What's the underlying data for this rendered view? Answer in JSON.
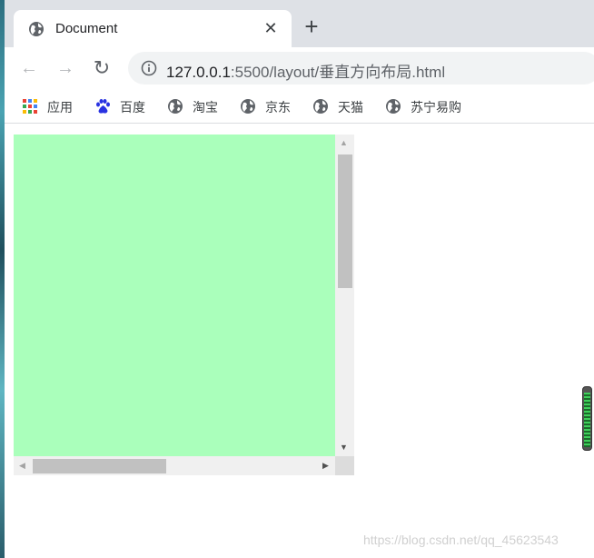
{
  "tab": {
    "title": "Document",
    "close": "✕",
    "new_tab": "+"
  },
  "toolbar": {
    "back": "←",
    "forward": "→",
    "reload": "↻",
    "url_host": "127.0.0.1",
    "url_rest": ":5500/layout/垂直方向布局.html"
  },
  "bookmarks": [
    {
      "label": "应用",
      "icon": "apps-grid-icon"
    },
    {
      "label": "百度",
      "icon": "baidu-paw-icon"
    },
    {
      "label": "淘宝",
      "icon": "globe-icon"
    },
    {
      "label": "京东",
      "icon": "globe-icon"
    },
    {
      "label": "天猫",
      "icon": "globe-icon"
    },
    {
      "label": "苏宁易购",
      "icon": "globe-icon"
    }
  ],
  "content": {
    "box_color": "#aaffbb",
    "vertical_scroll_position": 0.0,
    "horizontal_scroll_position": 0.0
  },
  "watermark": "https://blog.csdn.net/qq_45623543"
}
